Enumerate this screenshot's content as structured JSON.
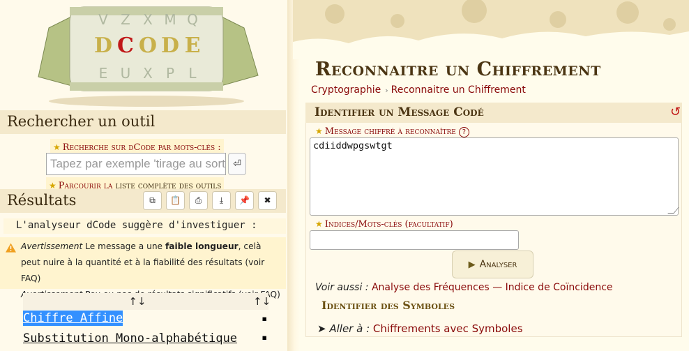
{
  "logo": {
    "alt": "dCode"
  },
  "search": {
    "title": "Rechercher un outil",
    "keyword_label": "Recherche sur dCode par mots-clés :",
    "placeholder": "Tapez par exemple 'tirage au sort'",
    "browse_prefix": "Parcourir la ",
    "browse_link": "liste complète des outils"
  },
  "results": {
    "title": "Résultats",
    "toolbar": [
      "copy",
      "paste",
      "print",
      "download",
      "pin",
      "close"
    ],
    "analyser_note": "L'analyseur dCode suggère d'investiguer :",
    "warnings": [
      {
        "tag": "Avertissement",
        "pre": " Le message a une ",
        "bold": "faible longueur",
        "post": ", celà peut nuire à la quantité et à la fiabilité des résultats (voir FAQ)"
      },
      {
        "tag": "Avertissement",
        "pre": " Peu ou pas de résultats significatifs (voir FAQ)",
        "bold": "",
        "post": ""
      }
    ],
    "table_headers": [
      "↑↓",
      "↑↓"
    ],
    "rows": [
      {
        "name": "Chiffre Affine",
        "mark": "▪"
      },
      {
        "name": "Substitution Mono-alphabétique",
        "mark": "▪"
      }
    ]
  },
  "page": {
    "title": "Reconnaitre un Chiffrement",
    "breadcrumbs": [
      "Cryptographie",
      "Reconnaitre un Chiffrement"
    ]
  },
  "tool": {
    "header": "Identifier un Message Codé",
    "message_label": "Message chiffré à reconnaître",
    "message_value": "cdiiddwpgswtgt",
    "hint_label": "Indices/Mots-clés (facultatif)",
    "hint_value": "",
    "analyse_button": "Analyser",
    "see_also_label": "Voir aussi :",
    "see_also_links": [
      "Analyse des Fréquences",
      "Indice de Coïncidence"
    ],
    "see_also_sep": "—",
    "symbols_header": "Identifier des Symboles",
    "go_to_label": "Aller à :",
    "go_to_link": "Chiffrements avec Symboles"
  },
  "colors": {
    "accent": "#8a0a0a",
    "title": "#4b3513",
    "panel": "#f4e9cc",
    "selection": "#3390ff"
  }
}
